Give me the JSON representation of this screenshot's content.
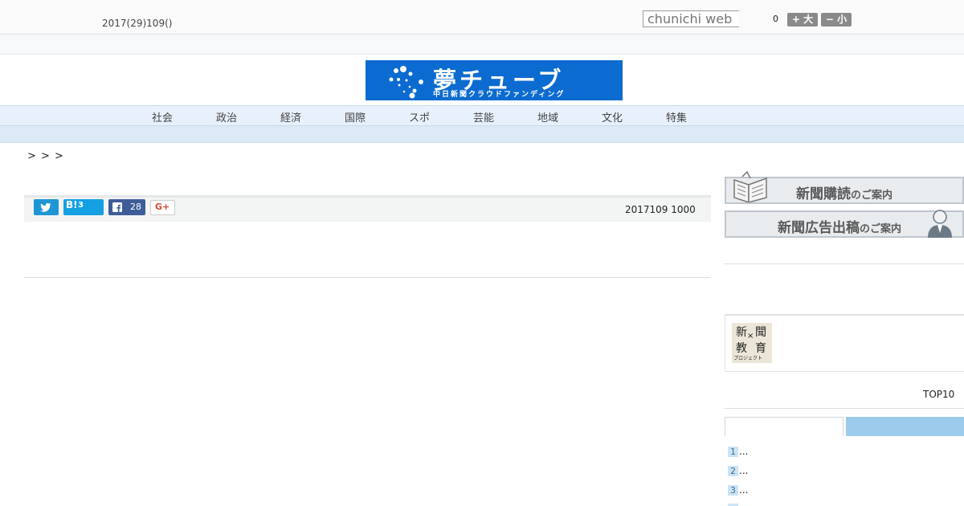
{
  "header": {
    "date": "2017(29)109()",
    "search_placeholder": "chunichi web",
    "count": "0",
    "font_large_label": "+ 大",
    "font_small_label": "− 小"
  },
  "banner": {
    "title": "夢チューブ",
    "subtitle": "中日新聞クラウドファンディング",
    "bg_color": "#0b6bd0"
  },
  "nav": {
    "items": [
      "社会",
      "政治",
      "経済",
      "国際",
      "スポ",
      "芸能",
      "地域",
      "文化",
      "特集"
    ]
  },
  "breadcrumb": "> > >",
  "share": {
    "hatena_label": "B!",
    "hatena_count": "3",
    "facebook_count": "28",
    "google_label": "G+",
    "twitter_color": "#1e96d6",
    "facebook_color": "#3e5d98"
  },
  "article": {
    "date": "2017109 1000"
  },
  "sidebar": {
    "subscribe_main": "新聞購読",
    "subscribe_sub": "のご案内",
    "ad_main": "新聞広告出稿",
    "ad_sub": "のご案内",
    "edu_chars": [
      "新",
      "聞",
      "教",
      "育"
    ],
    "edu_cross": "×",
    "edu_sub": "プロジェクト",
    "ranking_title": "TOP10",
    "ranking": [
      {
        "num": "1",
        "text": "..."
      },
      {
        "num": "2",
        "text": "..."
      },
      {
        "num": "3",
        "text": "..."
      }
    ]
  }
}
